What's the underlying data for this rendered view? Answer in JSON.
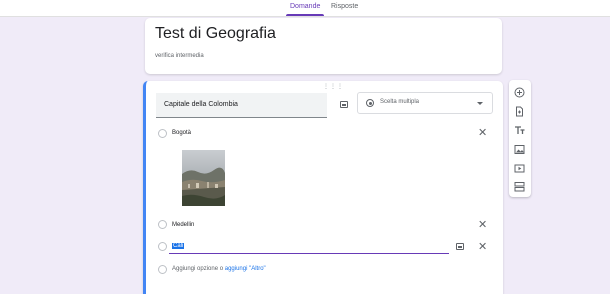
{
  "tabs": [
    {
      "label": "Domande"
    },
    {
      "label": "Risposte"
    }
  ],
  "form": {
    "title": "Test di Geografia",
    "description": "verifica intermedia"
  },
  "question": {
    "text": "Capitale della Colombia",
    "type": "Scelta multipla",
    "options": [
      {
        "label": "Bogotà"
      },
      {
        "label": "Medellin"
      },
      {
        "label": "Cali"
      }
    ],
    "add_option": "Aggiungi opzione",
    "or": "o",
    "add_other": "aggiungi \"Altro\""
  },
  "toolbar_icons": [
    "add-circle-icon",
    "import-question-icon",
    "title-text-icon",
    "image-icon",
    "video-icon",
    "section-icon"
  ],
  "colors": {
    "accent": "#673ab7",
    "focus_border": "#4285f4",
    "background": "#f0ebf8"
  }
}
